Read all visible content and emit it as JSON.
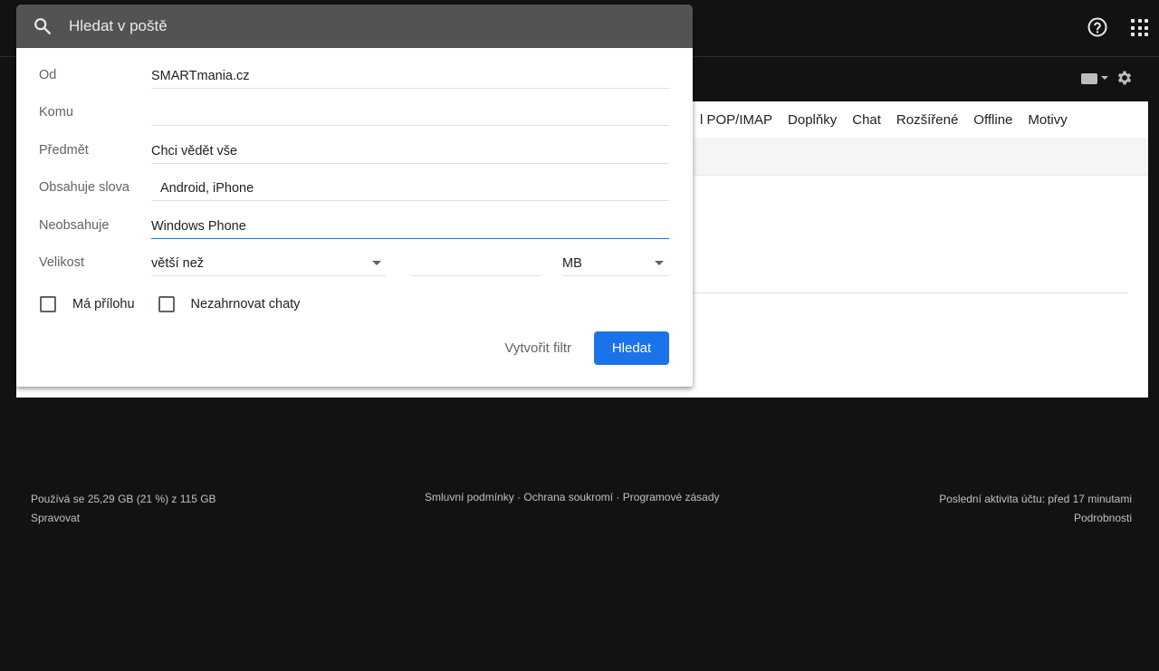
{
  "search": {
    "placeholder": "Hledat v poště"
  },
  "form": {
    "from": {
      "label": "Od",
      "value": "SMARTmania.cz"
    },
    "to": {
      "label": "Komu",
      "value": ""
    },
    "subject": {
      "label": "Předmět",
      "value": "Chci vědět vše"
    },
    "has_words": {
      "label": "Obsahuje slova",
      "value": "Android, iPhone"
    },
    "doesnt_have": {
      "label": "Neobsahuje",
      "value": "Windows Phone"
    },
    "size": {
      "label": "Velikost",
      "operator": "větší než",
      "value": "",
      "unit": "MB"
    },
    "has_attachment": {
      "label": "Má přílohu",
      "checked": false
    },
    "exclude_chats": {
      "label": "Nezahrnovat chaty",
      "checked": false
    },
    "create_filter_label": "Vytvořit filtr",
    "search_button_label": "Hledat"
  },
  "settings_tabs": [
    "l POP/IMAP",
    "Doplňky",
    "Chat",
    "Rozšířené",
    "Offline",
    "Motivy"
  ],
  "footer": {
    "storage": "Používá se 25,29 GB (21 %) z 115 GB",
    "manage": "Spravovat",
    "terms": "Smluvní podmínky",
    "privacy": "Ochrana soukromí",
    "policies": "Programové zásady",
    "separator": " · ",
    "last_activity": "Poslední aktivita účtu: před 17 minutami",
    "details": "Podrobnosti"
  },
  "colors": {
    "background": "#121212",
    "accent": "#1a73e8",
    "search_bar": "#525355"
  }
}
